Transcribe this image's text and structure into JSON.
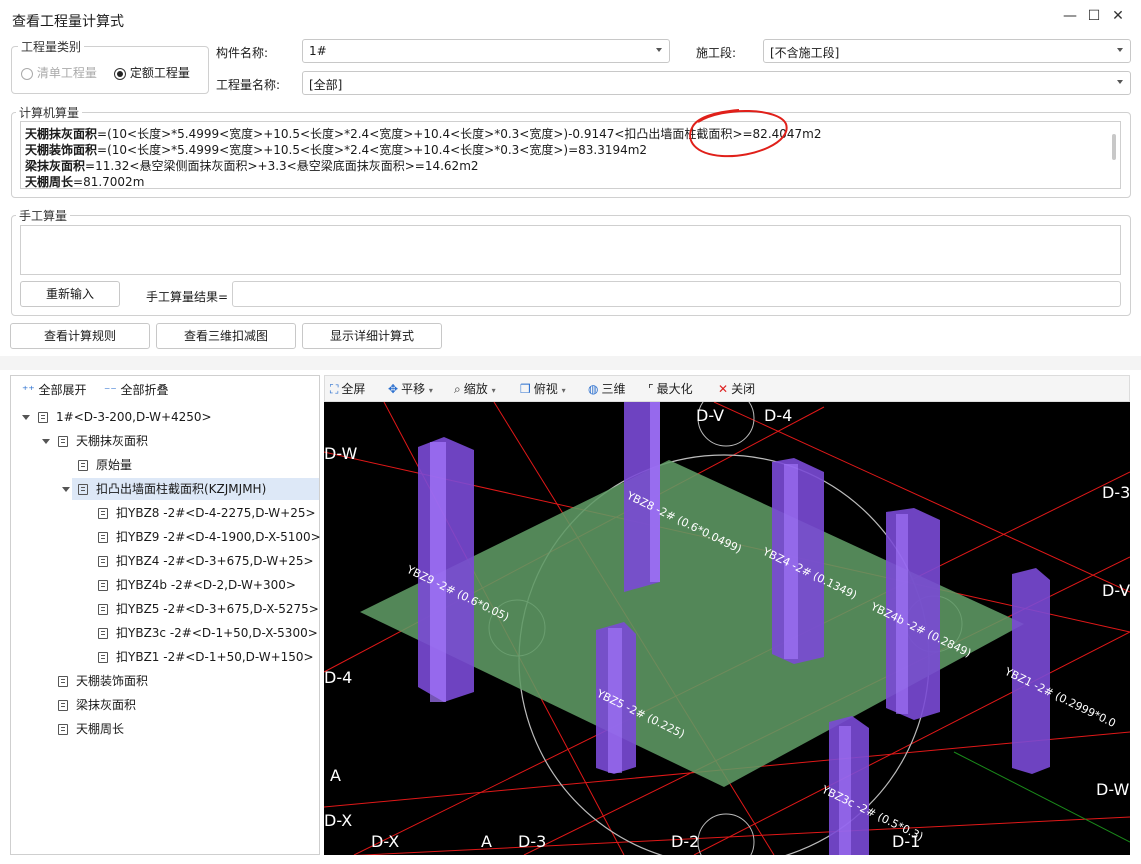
{
  "window": {
    "title": "查看工程量计算式",
    "controls": [
      "—",
      "☐",
      "✕"
    ]
  },
  "quantity_type": {
    "legend": "工程量类别",
    "options": [
      {
        "label": "清单工程量",
        "checked": false,
        "enabled": false
      },
      {
        "label": "定额工程量",
        "checked": true,
        "enabled": true
      }
    ]
  },
  "filters": {
    "component_label": "构件名称:",
    "component_value": "1#",
    "stage_label": "施工段:",
    "stage_value": "[不含施工段]",
    "qty_name_label": "工程量名称:",
    "qty_name_value": "[全部]"
  },
  "computer_calc": {
    "legend": "计算机算量",
    "lines": [
      {
        "name": "天棚抹灰面积",
        "text": "=(10<长度>*5.4999<宽度>+10.5<长度>*2.4<宽度>+10.4<长度>*0.3<宽度>)-0.9147<扣凸出墙面柱截面积>=82.4047m2"
      },
      {
        "name": "天棚装饰面积",
        "text": "=(10<长度>*5.4999<宽度>+10.5<长度>*2.4<宽度>+10.4<长度>*0.3<宽度>)=83.3194m2"
      },
      {
        "name": "梁抹灰面积",
        "text": "=11.32<悬空梁侧面抹灰面积>+3.3<悬空梁底面抹灰面积>=14.62m2"
      },
      {
        "name": "天棚周长",
        "text": "=81.7002m"
      }
    ]
  },
  "manual_calc": {
    "legend": "手工算量",
    "reinput_button": "重新输入",
    "result_label": "手工算量结果=",
    "result_value": ""
  },
  "actions": {
    "rules_button": "查看计算规则",
    "view3d_button": "查看三维扣减图",
    "detail_button": "显示详细计算式"
  },
  "tree": {
    "expand_all": "全部展开",
    "collapse_all": "全部折叠",
    "items": [
      {
        "label": "1#<D-3-200,D-W+4250>",
        "level": 0,
        "caret": true
      },
      {
        "label": "天棚抹灰面积",
        "level": 1,
        "caret": true
      },
      {
        "label": "原始量",
        "level": 2,
        "caret": false
      },
      {
        "label": "扣凸出墙面柱截面积(KZJMJMH)",
        "level": 2,
        "caret": true,
        "selected": true
      },
      {
        "label": "扣YBZ8 -2#<D-4-2275,D-W+25>",
        "level": 3,
        "caret": false
      },
      {
        "label": "扣YBZ9 -2#<D-4-1900,D-X-5100>",
        "level": 3,
        "caret": false
      },
      {
        "label": "扣YBZ4 -2#<D-3+675,D-W+25>",
        "level": 3,
        "caret": false
      },
      {
        "label": "扣YBZ4b -2#<D-2,D-W+300>",
        "level": 3,
        "caret": false
      },
      {
        "label": "扣YBZ5 -2#<D-3+675,D-X-5275>",
        "level": 3,
        "caret": false
      },
      {
        "label": "扣YBZ3c -2#<D-1+50,D-X-5300>",
        "level": 3,
        "caret": false
      },
      {
        "label": "扣YBZ1 -2#<D-1+50,D-W+150>",
        "level": 3,
        "caret": false
      },
      {
        "label": "天棚装饰面积",
        "level": 1,
        "caret": false
      },
      {
        "label": "梁抹灰面积",
        "level": 1,
        "caret": false
      },
      {
        "label": "天棚周长",
        "level": 1,
        "caret": false
      }
    ]
  },
  "viewer_toolbar": {
    "fullscreen": "全屏",
    "pan": "平移",
    "zoom": "缩放",
    "topview": "俯视",
    "threed": "三维",
    "maximize": "最大化",
    "close": "关闭"
  },
  "viewer": {
    "axis_labels": {
      "dv": "D-V",
      "d4": "D-4",
      "dw": "D-W",
      "d3r": "D-3",
      "dvr": "D-V",
      "d4l": "D-4",
      "dwr": "D-W",
      "dxl": "D-X",
      "dxb": "D-X",
      "d3b": "D-3",
      "d2b": "D-2",
      "d1b": "D-1",
      "a1": "A",
      "a2": "A"
    },
    "column_labels": {
      "ybz8": "YBZ8 -2# (0.6*0.0499)",
      "ybz9": "YBZ9 -2# (0.6*0.05)",
      "ybz4": "YBZ4 -2# (0.1349)",
      "ybz4b": "YBZ4b -2# (0.2849)",
      "ybz5": "YBZ5 -2# (0.225)",
      "ybz1": "YBZ1 -2# (0.2999*0.0",
      "ybz3c": "YBZ3c -2# (0.5*0.3)"
    }
  }
}
